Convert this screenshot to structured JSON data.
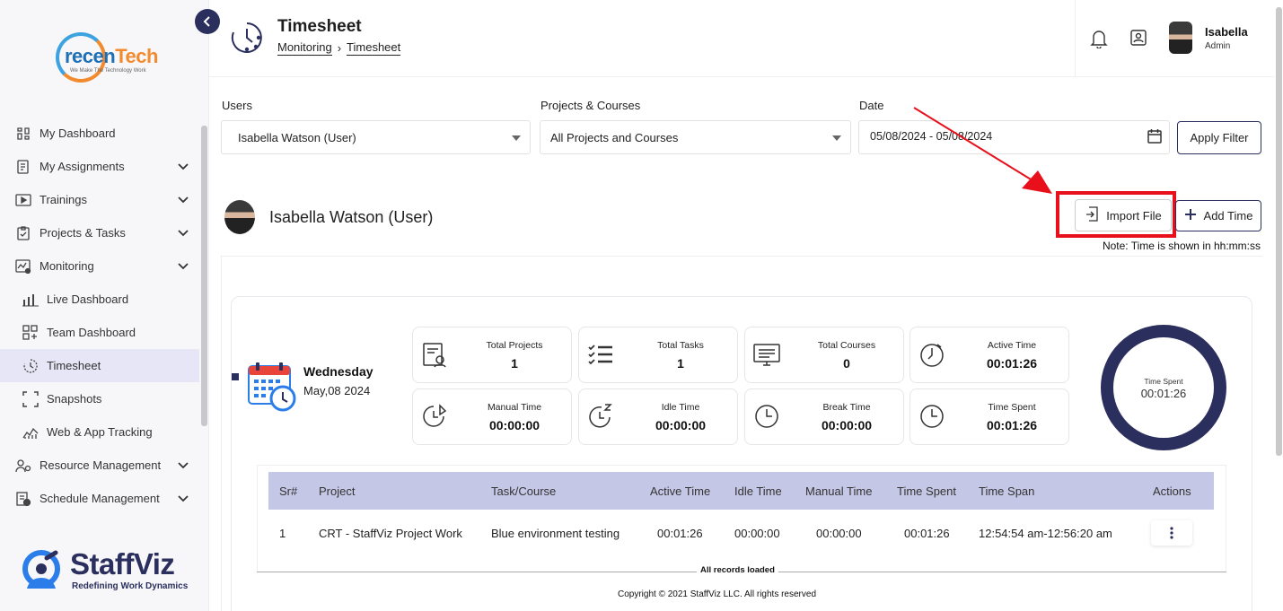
{
  "sidebar": {
    "logo": {
      "text_a": "recen",
      "text_b": "Tech",
      "tagline": "We Make The Technology Work"
    },
    "items": [
      {
        "label": "My Dashboard",
        "icon": "dashboard-icon",
        "has_chevron": false
      },
      {
        "label": "My Assignments",
        "icon": "assignment-icon",
        "has_chevron": true
      },
      {
        "label": "Trainings",
        "icon": "play-icon",
        "has_chevron": true
      },
      {
        "label": "Projects & Tasks",
        "icon": "clipboard-check-icon",
        "has_chevron": true
      },
      {
        "label": "Monitoring",
        "icon": "monitoring-icon",
        "has_chevron": true
      }
    ],
    "sub_items": [
      {
        "label": "Live Dashboard",
        "icon": "bar-chart-icon"
      },
      {
        "label": "Team Dashboard",
        "icon": "grid-add-icon"
      },
      {
        "label": "Timesheet",
        "icon": "timer-icon",
        "active": true
      },
      {
        "label": "Snapshots",
        "icon": "frame-icon"
      },
      {
        "label": "Web & App Tracking",
        "icon": "line-chart-icon"
      }
    ],
    "bottom_items": [
      {
        "label": "Resource Management",
        "icon": "users-gear-icon"
      },
      {
        "label": "Schedule Management",
        "icon": "schedule-icon"
      }
    ],
    "brand": {
      "name": "StaffViz",
      "tagline": "Redefining Work Dynamics"
    }
  },
  "header": {
    "title": "Timesheet",
    "breadcrumb": [
      "Monitoring",
      "Timesheet"
    ],
    "user_name": "Isabella",
    "user_role": "Admin"
  },
  "filters": {
    "users_label": "Users",
    "users_value": "Isabella Watson (User)",
    "projects_label": "Projects & Courses",
    "projects_value": "All Projects and Courses",
    "date_label": "Date",
    "date_value": "05/08/2024 - 05/08/2024",
    "apply_label": "Apply Filter"
  },
  "user_section": {
    "name": "Isabella Watson (User)",
    "import_label": "Import File",
    "add_label": "Add Time",
    "note": "Note: Time is shown in hh:mm:ss"
  },
  "day": {
    "name": "Wednesday",
    "date": "May,08 2024"
  },
  "stats": [
    {
      "label": "Total Projects",
      "value": "1",
      "icon": "project-report-icon"
    },
    {
      "label": "Total Tasks",
      "value": "1",
      "icon": "checklist-icon"
    },
    {
      "label": "Total Courses",
      "value": "0",
      "icon": "course-monitor-icon"
    },
    {
      "label": "Active Time",
      "value": "00:01:26",
      "icon": "active-clock-icon"
    },
    {
      "label": "Manual Time",
      "value": "00:00:00",
      "icon": "manual-clock-icon"
    },
    {
      "label": "Idle Time",
      "value": "00:00:00",
      "icon": "idle-clock-icon"
    },
    {
      "label": "Break Time",
      "value": "00:00:00",
      "icon": "break-clock-icon"
    },
    {
      "label": "Time Spent",
      "value": "00:01:26",
      "icon": "spent-clock-icon"
    }
  ],
  "donut": {
    "label": "Time Spent",
    "value": "00:01:26",
    "color": "#2b2f5e"
  },
  "table": {
    "columns": [
      "Sr#",
      "Project",
      "Task/Course",
      "Active Time",
      "Idle Time",
      "Manual Time",
      "Time Spent",
      "Time Span",
      "Actions"
    ],
    "rows": [
      [
        "1",
        "CRT - StaffViz Project Work",
        "Blue environment testing",
        "00:01:26",
        "00:00:00",
        "00:00:00",
        "00:01:26",
        "12:54:54 am-12:56:20 am"
      ]
    ],
    "footer": "All records loaded"
  },
  "copyright": "Copyright © 2021 StaffViz LLC. All rights reserved",
  "colors": {
    "primary": "#2b2f5e",
    "table_header": "#c5c7e6",
    "highlight": "#e8101a"
  }
}
